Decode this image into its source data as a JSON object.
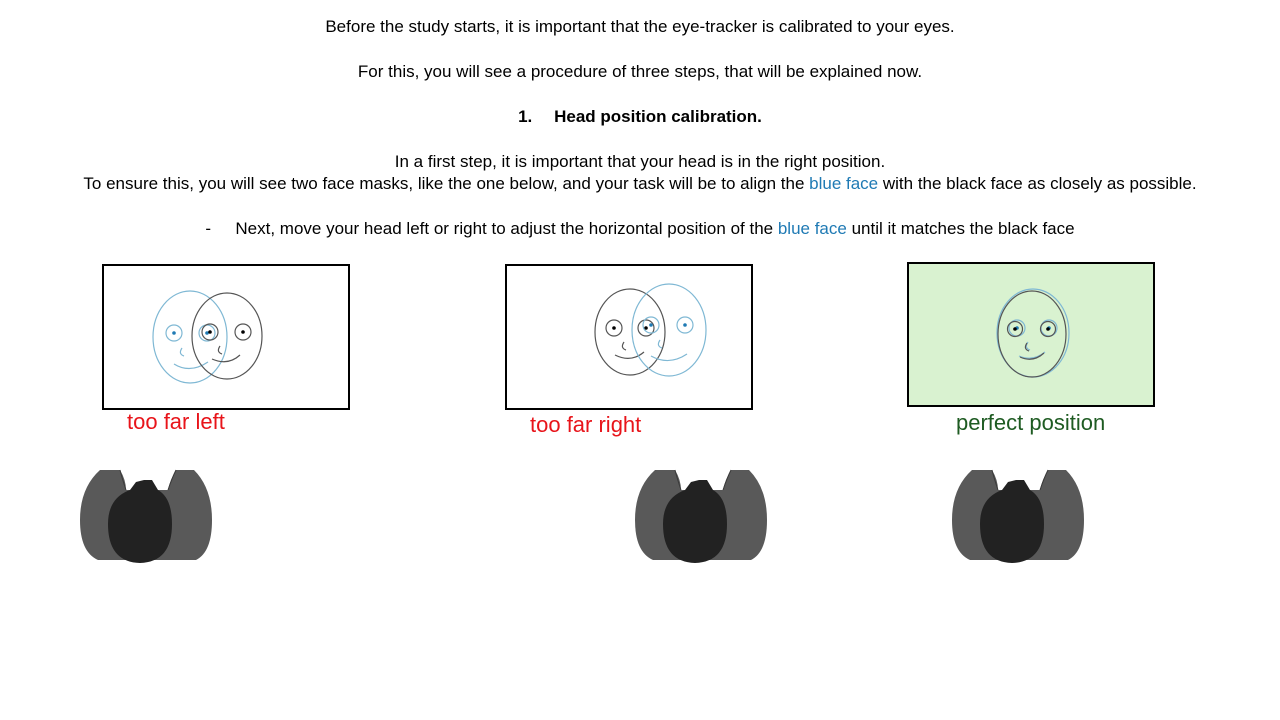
{
  "intro": {
    "line1": "Before the study starts, it is important that the eye-tracker is calibrated to your eyes.",
    "line2": "For this, you will see a procedure of three steps, that will be explained now."
  },
  "step": {
    "number": "1.",
    "title": "Head position calibration."
  },
  "explanation": {
    "line1": "In a first step, it is important that your head is in the right position.",
    "line2_part1": "To ensure this, you will see two face masks, like the one below, and your task will be to align the",
    "line2_blue": "blue face",
    "line2_part2": "with the black face as closely as possible."
  },
  "instruction": {
    "bullet": "-",
    "part1": "Next, move your head left or right to adjust the horizontal position of the",
    "blue": "blue face",
    "part2": "until it matches the black face"
  },
  "examples": [
    {
      "caption": "too far left",
      "caption_color": "#e8141a"
    },
    {
      "caption": "too far right",
      "caption_color": "#e8141a"
    },
    {
      "caption": "perfect position",
      "caption_color": "#1e5b22"
    }
  ],
  "colors": {
    "blue_text": "#1f7ab4",
    "blue_face": "#7fb8d4",
    "black_face": "#555555",
    "perfect_background": "#d9f2d0",
    "person_body": "#595959",
    "person_head": "#222222"
  }
}
